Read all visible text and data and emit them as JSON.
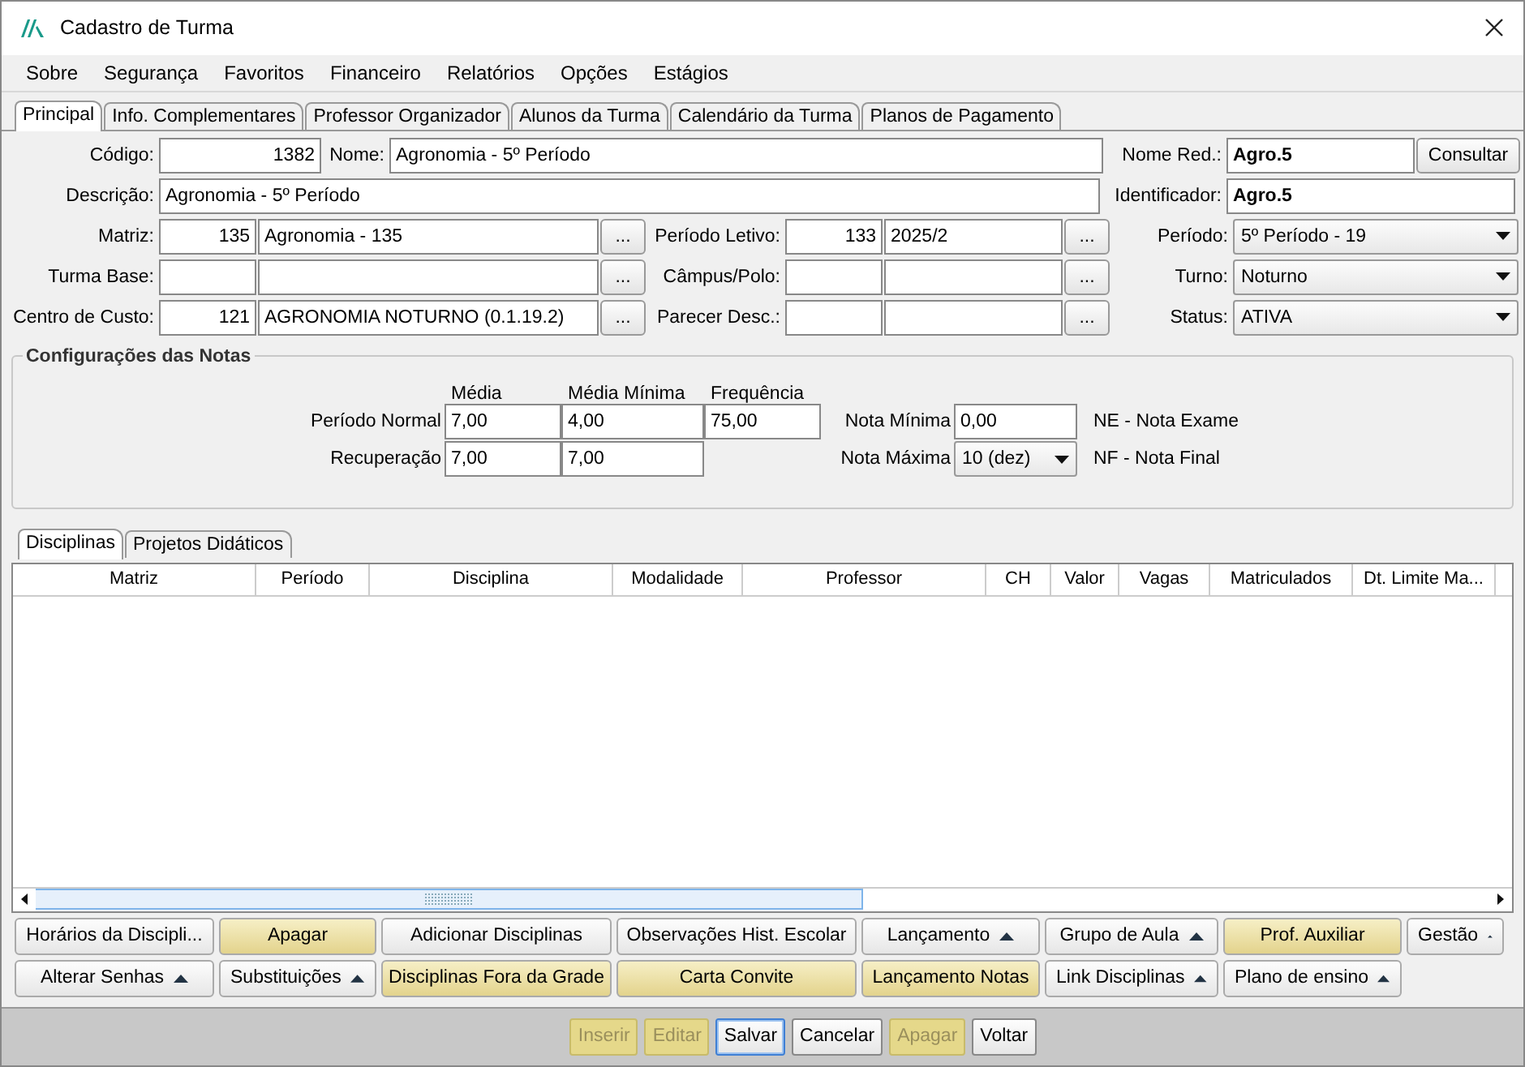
{
  "window": {
    "title": "Cadastro de Turma"
  },
  "menu": [
    "Sobre",
    "Segurança",
    "Favoritos",
    "Financeiro",
    "Relatórios",
    "Opções",
    "Estágios"
  ],
  "tabs": [
    {
      "label": "Principal",
      "selected": true
    },
    {
      "label": "Info. Complementares",
      "selected": false
    },
    {
      "label": "Professor Organizador",
      "selected": false
    },
    {
      "label": "Alunos da Turma",
      "selected": false
    },
    {
      "label": "Calendário da Turma",
      "selected": false
    },
    {
      "label": "Planos de Pagamento",
      "selected": false
    }
  ],
  "form": [
    {
      "items": [
        {
          "kind": "label",
          "text": "Código:"
        },
        {
          "kind": "number_field",
          "value": "1382"
        },
        {
          "kind": "label",
          "text": "Nome:"
        },
        {
          "kind": "text_field",
          "value": "Agronomia - 5º Período"
        },
        {
          "kind": "label",
          "text": "Nome Red.:"
        },
        {
          "kind": "strong_field",
          "value": "Agro.5"
        },
        {
          "kind": "button",
          "text": "Consultar"
        }
      ]
    },
    {
      "items": [
        {
          "kind": "label",
          "text": "Descrição:"
        },
        {
          "kind": "text_field",
          "value": "Agronomia - 5º Período"
        },
        {
          "kind": "label",
          "text": "Identificador:"
        },
        {
          "kind": "strong_field",
          "value": "Agro.5"
        }
      ]
    },
    {
      "items": [
        {
          "kind": "label",
          "text": "Matriz:"
        },
        {
          "kind": "number_field",
          "value": "135"
        },
        {
          "kind": "text_field",
          "value": "Agronomia - 135"
        },
        {
          "kind": "lookup",
          "text": "..."
        },
        {
          "kind": "label",
          "text": "Período Letivo:"
        },
        {
          "kind": "number_field",
          "value": "133"
        },
        {
          "kind": "text_field",
          "value": "2025/2"
        },
        {
          "kind": "lookup",
          "text": "..."
        },
        {
          "kind": "label",
          "text": "Período:"
        },
        {
          "kind": "select",
          "value": "5º Período - 19"
        }
      ]
    },
    {
      "items": [
        {
          "kind": "label",
          "text": "Turma Base:"
        },
        {
          "kind": "number_field"
        },
        {
          "kind": "text_field"
        },
        {
          "kind": "lookup",
          "text": "..."
        },
        {
          "kind": "label",
          "text": "Câmpus/Polo:"
        },
        {
          "kind": "number_field"
        },
        {
          "kind": "text_field"
        },
        {
          "kind": "lookup",
          "text": "..."
        },
        {
          "kind": "label",
          "text": "Turno:"
        },
        {
          "kind": "select",
          "value": "Noturno"
        }
      ]
    },
    {
      "items": [
        {
          "kind": "label",
          "text": "Centro de Custo:"
        },
        {
          "kind": "number_field",
          "value": "121"
        },
        {
          "kind": "text_field",
          "value": "AGRONOMIA NOTURNO (0.1.19.2)"
        },
        {
          "kind": "lookup",
          "text": "..."
        },
        {
          "kind": "label",
          "text": "Parecer Desc.:"
        },
        {
          "kind": "number_field"
        },
        {
          "kind": "text_field"
        },
        {
          "kind": "lookup",
          "text": "..."
        },
        {
          "kind": "label",
          "text": "Status:"
        },
        {
          "kind": "select",
          "value": "ATIVA"
        }
      ]
    }
  ],
  "grades": {
    "title": "Configurações das Notas",
    "headers": [
      "Média",
      "Média Mínima",
      "Frequência"
    ],
    "rows": [
      {
        "label": "Período Normal",
        "values": [
          "7,00",
          "4,00",
          "75,00"
        ],
        "extra": {
          "kind": "field",
          "label": "Nota Mínima",
          "value": "0,00"
        },
        "legend": "NE - Nota Exame"
      },
      {
        "label": "Recuperação",
        "values": [
          "7,00",
          "7,00"
        ],
        "extra": {
          "kind": "select",
          "label": "Nota Máxima",
          "value": "10 (dez)"
        },
        "legend": "NF - Nota Final"
      }
    ]
  },
  "sub_tabs": [
    {
      "label": "Disciplinas",
      "selected": true
    },
    {
      "label": "Projetos Didáticos",
      "selected": false
    }
  ],
  "table": {
    "columns": [
      "Matriz",
      "Período",
      "Disciplina",
      "Modalidade",
      "Professor",
      "CH",
      "Valor",
      "Vagas",
      "Matriculados",
      "Dt. Limite Ma..."
    ]
  },
  "action_rows": [
    [
      {
        "label": "Horários da Discipli...",
        "kind": "normal",
        "menu": false
      },
      {
        "label": "Apagar",
        "kind": "highlighted",
        "menu": false
      },
      {
        "label": "Adicionar Disciplinas",
        "kind": "normal",
        "menu": false
      },
      {
        "label": "Observações Hist. Escolar",
        "kind": "normal",
        "menu": false
      },
      {
        "label": "Lançamento",
        "kind": "normal",
        "menu": true
      },
      {
        "label": "Grupo de Aula",
        "kind": "normal",
        "menu": true
      },
      {
        "label": "Prof. Auxiliar",
        "kind": "highlighted",
        "menu": false
      },
      {
        "label": "Gestão",
        "kind": "normal",
        "menu": true
      }
    ],
    [
      {
        "label": "Alterar Senhas",
        "kind": "normal",
        "menu": true
      },
      {
        "label": "Substituições",
        "kind": "normal",
        "menu": true
      },
      {
        "label": "Disciplinas Fora da Grade",
        "kind": "highlighted",
        "menu": false
      },
      {
        "label": "Carta Convite",
        "kind": "highlighted",
        "menu": false
      },
      {
        "label": "Lançamento Notas",
        "kind": "highlighted",
        "menu": false
      },
      {
        "label": "Link Disciplinas",
        "kind": "normal",
        "menu": true
      },
      {
        "label": "Plano de ensino",
        "kind": "normal",
        "menu": true
      }
    ]
  ],
  "footer": [
    {
      "label": "Inserir",
      "disabled": true,
      "focused": false
    },
    {
      "label": "Editar",
      "disabled": true,
      "focused": false
    },
    {
      "label": "Salvar",
      "disabled": false,
      "focused": true
    },
    {
      "label": "Cancelar",
      "disabled": false,
      "focused": false
    },
    {
      "label": "Apagar",
      "disabled": true,
      "focused": false
    },
    {
      "label": "Voltar",
      "disabled": false,
      "focused": false
    }
  ]
}
